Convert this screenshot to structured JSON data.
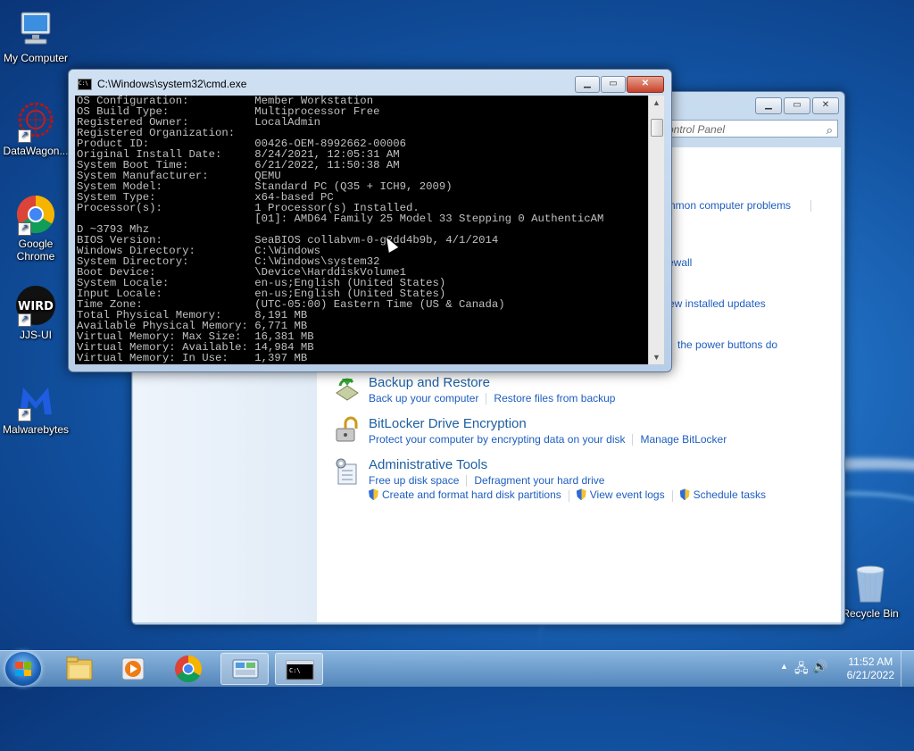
{
  "desktop": {
    "icons": [
      {
        "label": "My Computer"
      },
      {
        "label": "DataWagon..."
      },
      {
        "label": "Google Chrome"
      },
      {
        "label": "JJS-UI"
      },
      {
        "label": "Malwarebytes"
      },
      {
        "label": "Recycle Bin"
      }
    ],
    "logo_text": "WIRD"
  },
  "control_panel": {
    "search_placeholder": "ontrol Panel",
    "partial_links": [
      "nmon computer problems",
      "ewall",
      "ew installed updates",
      "the power buttons do"
    ],
    "categories": [
      {
        "title": "Backup and Restore",
        "links": [
          "Back up your computer",
          "Restore files from backup"
        ]
      },
      {
        "title": "BitLocker Drive Encryption",
        "links": [
          "Protect your computer by encrypting data on your disk",
          "Manage BitLocker"
        ]
      },
      {
        "title": "Administrative Tools",
        "links": [
          "Free up disk space",
          "Defragment your hard drive"
        ],
        "admin_links": [
          "Create and format hard disk partitions",
          "View event logs",
          "Schedule tasks"
        ]
      }
    ]
  },
  "cmd": {
    "title": "C:\\Windows\\system32\\cmd.exe",
    "icon_text": "C:\\",
    "lines": [
      "OS Configuration:          Member Workstation",
      "OS Build Type:             Multiprocessor Free",
      "Registered Owner:          LocalAdmin",
      "Registered Organization:",
      "Product ID:                00426-OEM-8992662-00006",
      "Original Install Date:     8/24/2021, 12:05:31 AM",
      "System Boot Time:          6/21/2022, 11:50:38 AM",
      "System Manufacturer:       QEMU",
      "System Model:              Standard PC (Q35 + ICH9, 2009)",
      "System Type:               x64-based PC",
      "Processor(s):              1 Processor(s) Installed.",
      "                           [01]: AMD64 Family 25 Model 33 Stepping 0 AuthenticAM",
      "D ~3793 Mhz",
      "BIOS Version:              SeaBIOS collabvm-0-g2dd4b9b, 4/1/2014",
      "Windows Directory:         C:\\Windows",
      "System Directory:          C:\\Windows\\system32",
      "Boot Device:               \\Device\\HarddiskVolume1",
      "System Locale:             en-us;English (United States)",
      "Input Locale:              en-us;English (United States)",
      "Time Zone:                 (UTC-05:00) Eastern Time (US & Canada)",
      "Total Physical Memory:     8,191 MB",
      "Available Physical Memory: 6,771 MB",
      "Virtual Memory: Max Size:  16,381 MB",
      "Virtual Memory: Available: 14,984 MB",
      "Virtual Memory: In Use:    1,397 MB"
    ]
  },
  "taskbar": {
    "time": "11:52 AM",
    "date": "6/21/2022",
    "cmd_icon_text": "C:\\"
  }
}
